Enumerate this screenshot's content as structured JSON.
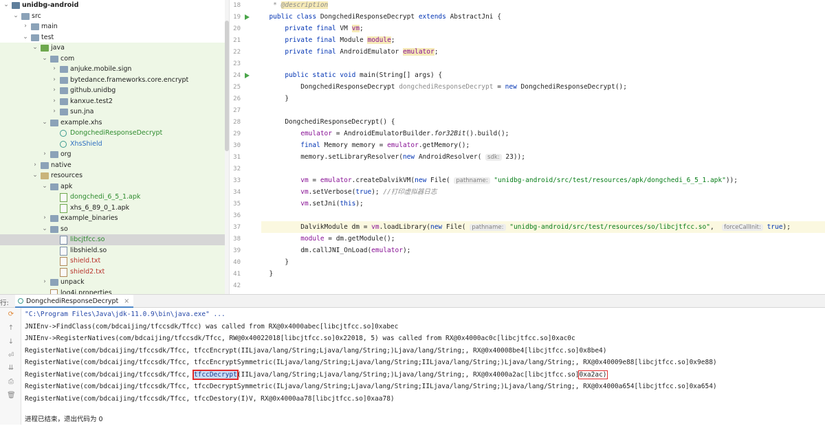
{
  "project_tree": {
    "items": [
      {
        "label": "unidbg-android",
        "depth": 0,
        "expanded": true,
        "icon": "project-folder-icon",
        "kind": "project",
        "style": "bold"
      },
      {
        "label": "src",
        "depth": 1,
        "expanded": true,
        "icon": "folder-icon",
        "kind": "folder"
      },
      {
        "label": "main",
        "depth": 2,
        "expanded": false,
        "icon": "folder-icon",
        "kind": "folder"
      },
      {
        "label": "test",
        "depth": 2,
        "expanded": true,
        "icon": "folder-icon",
        "kind": "folder"
      },
      {
        "label": "java",
        "depth": 3,
        "expanded": true,
        "icon": "test-source-folder-icon",
        "kind": "green-folder",
        "test": true
      },
      {
        "label": "com",
        "depth": 4,
        "expanded": true,
        "icon": "package-icon",
        "kind": "folder",
        "test": true
      },
      {
        "label": "anjuke.mobile.sign",
        "depth": 5,
        "expanded": false,
        "icon": "package-icon",
        "kind": "folder",
        "test": true
      },
      {
        "label": "bytedance.frameworks.core.encrypt",
        "depth": 5,
        "expanded": false,
        "icon": "package-icon",
        "kind": "folder",
        "test": true
      },
      {
        "label": "github.unidbg",
        "depth": 5,
        "expanded": false,
        "icon": "package-icon",
        "kind": "folder",
        "test": true
      },
      {
        "label": "kanxue.test2",
        "depth": 5,
        "expanded": false,
        "icon": "package-icon",
        "kind": "folder",
        "test": true
      },
      {
        "label": "sun.jna",
        "depth": 5,
        "expanded": false,
        "icon": "package-icon",
        "kind": "folder",
        "test": true
      },
      {
        "label": "example.xhs",
        "depth": 4,
        "expanded": true,
        "icon": "package-icon",
        "kind": "folder",
        "test": true
      },
      {
        "label": "DongchediResponseDecrypt",
        "depth": 5,
        "icon": "java-class-icon",
        "kind": "class",
        "color": "green",
        "test": true
      },
      {
        "label": "XhsShield",
        "depth": 5,
        "icon": "java-class-icon",
        "kind": "class",
        "color": "blue",
        "test": true
      },
      {
        "label": "org",
        "depth": 4,
        "expanded": false,
        "icon": "package-icon",
        "kind": "folder",
        "test": true
      },
      {
        "label": "native",
        "depth": 3,
        "expanded": false,
        "icon": "folder-icon",
        "kind": "folder",
        "test": true
      },
      {
        "label": "resources",
        "depth": 3,
        "expanded": true,
        "icon": "resources-folder-icon",
        "kind": "res-folder",
        "test": true
      },
      {
        "label": "apk",
        "depth": 4,
        "expanded": true,
        "icon": "folder-icon",
        "kind": "folder",
        "test": true
      },
      {
        "label": "dongchedi_6_5_1.apk",
        "depth": 5,
        "icon": "apk-file-icon",
        "kind": "apk",
        "color": "green",
        "test": true
      },
      {
        "label": "xhs_6_89_0_1.apk",
        "depth": 5,
        "icon": "apk-file-icon",
        "kind": "apk",
        "test": true
      },
      {
        "label": "example_binaries",
        "depth": 4,
        "expanded": false,
        "icon": "folder-icon",
        "kind": "folder",
        "test": true
      },
      {
        "label": "so",
        "depth": 4,
        "expanded": true,
        "icon": "folder-icon",
        "kind": "folder",
        "test": true
      },
      {
        "label": "libcjtfcc.so",
        "depth": 5,
        "icon": "so-file-icon",
        "kind": "so",
        "color": "green",
        "selected": true,
        "test": true
      },
      {
        "label": "libshield.so",
        "depth": 5,
        "icon": "so-file-icon",
        "kind": "so",
        "test": true
      },
      {
        "label": "shield.txt",
        "depth": 5,
        "icon": "text-file-icon",
        "kind": "txt",
        "color": "red",
        "test": true
      },
      {
        "label": "shield2.txt",
        "depth": 5,
        "icon": "text-file-icon",
        "kind": "txt",
        "color": "red",
        "test": true
      },
      {
        "label": "unpack",
        "depth": 4,
        "expanded": false,
        "icon": "folder-icon",
        "kind": "folder",
        "test": true
      },
      {
        "label": "log4j.properties",
        "depth": 4,
        "icon": "properties-file-icon",
        "kind": "txt",
        "test": true
      }
    ]
  },
  "editor": {
    "lines": [
      {
        "n": "18",
        "parts": [
          {
            "t": " * ",
            "c": "cmt"
          },
          {
            "t": "@description",
            "c": "cmt warn"
          }
        ]
      },
      {
        "n": "19",
        "run": true,
        "parts": [
          {
            "t": "public class ",
            "c": "kw"
          },
          {
            "t": "DongchediResponseDecrypt "
          },
          {
            "t": "extends ",
            "c": "kw"
          },
          {
            "t": "AbstractJni {"
          }
        ]
      },
      {
        "n": "20",
        "parts": [
          {
            "t": "    "
          },
          {
            "t": "private final ",
            "c": "kw"
          },
          {
            "t": "VM "
          },
          {
            "t": "vm",
            "c": "fld warn"
          },
          {
            "t": ";"
          }
        ]
      },
      {
        "n": "21",
        "parts": [
          {
            "t": "    "
          },
          {
            "t": "private final ",
            "c": "kw"
          },
          {
            "t": "Module "
          },
          {
            "t": "module",
            "c": "fld warn"
          },
          {
            "t": ";"
          }
        ]
      },
      {
        "n": "22",
        "parts": [
          {
            "t": "    "
          },
          {
            "t": "private final ",
            "c": "kw"
          },
          {
            "t": "AndroidEmulator "
          },
          {
            "t": "emulator",
            "c": "fld warn"
          },
          {
            "t": ";"
          }
        ]
      },
      {
        "n": "23",
        "parts": []
      },
      {
        "n": "24",
        "run": true,
        "parts": [
          {
            "t": "    "
          },
          {
            "t": "public static void ",
            "c": "kw"
          },
          {
            "t": "main(String[] args) {"
          }
        ]
      },
      {
        "n": "25",
        "parts": [
          {
            "t": "        DongchediResponseDecrypt "
          },
          {
            "t": "dongchediResponseDecrypt",
            "c": "gray"
          },
          {
            "t": " = "
          },
          {
            "t": "new ",
            "c": "kw"
          },
          {
            "t": "DongchediResponseDecrypt();"
          }
        ]
      },
      {
        "n": "26",
        "parts": [
          {
            "t": "    }"
          }
        ]
      },
      {
        "n": "27",
        "parts": []
      },
      {
        "n": "28",
        "parts": [
          {
            "t": "    DongchediResponseDecrypt() {"
          }
        ]
      },
      {
        "n": "29",
        "parts": [
          {
            "t": "        "
          },
          {
            "t": "emulator",
            "c": "fld"
          },
          {
            "t": " = AndroidEmulatorBuilder."
          },
          {
            "t": "for32Bit",
            "c": "static-it"
          },
          {
            "t": "().build();"
          }
        ]
      },
      {
        "n": "30",
        "parts": [
          {
            "t": "        "
          },
          {
            "t": "final ",
            "c": "kw"
          },
          {
            "t": "Memory memory = "
          },
          {
            "t": "emulator",
            "c": "fld"
          },
          {
            "t": ".getMemory();"
          }
        ]
      },
      {
        "n": "31",
        "parts": [
          {
            "t": "        memory.setLibraryResolver("
          },
          {
            "t": "new ",
            "c": "kw"
          },
          {
            "t": "AndroidResolver( "
          },
          {
            "t": "sdk:",
            "c": "hint"
          },
          {
            "t": " 23));"
          }
        ]
      },
      {
        "n": "32",
        "parts": []
      },
      {
        "n": "33",
        "parts": [
          {
            "t": "        "
          },
          {
            "t": "vm",
            "c": "fld"
          },
          {
            "t": " = "
          },
          {
            "t": "emulator",
            "c": "fld"
          },
          {
            "t": ".createDalvikVM("
          },
          {
            "t": "new ",
            "c": "kw"
          },
          {
            "t": "File( "
          },
          {
            "t": "pathname:",
            "c": "hint"
          },
          {
            "t": " "
          },
          {
            "t": "\"unidbg-android/src/test/resources/apk/dongchedi_6_5_1.apk\"",
            "c": "str"
          },
          {
            "t": "));"
          }
        ]
      },
      {
        "n": "34",
        "parts": [
          {
            "t": "        "
          },
          {
            "t": "vm",
            "c": "fld"
          },
          {
            "t": ".setVerbose("
          },
          {
            "t": "true",
            "c": "kw"
          },
          {
            "t": "); "
          },
          {
            "t": "//打印虚拟器日志",
            "c": "cmt"
          }
        ]
      },
      {
        "n": "35",
        "parts": [
          {
            "t": "        "
          },
          {
            "t": "vm",
            "c": "fld"
          },
          {
            "t": ".setJni("
          },
          {
            "t": "this",
            "c": "kw"
          },
          {
            "t": ");"
          }
        ]
      },
      {
        "n": "36",
        "parts": []
      },
      {
        "n": "37",
        "hl": true,
        "parts": [
          {
            "t": "        DalvikModule dm = "
          },
          {
            "t": "vm",
            "c": "fld"
          },
          {
            "t": ".loadLibrary("
          },
          {
            "t": "new ",
            "c": "kw"
          },
          {
            "t": "File( "
          },
          {
            "t": "pathname:",
            "c": "hint"
          },
          {
            "t": " "
          },
          {
            "t": "\"unidbg-android/src/test/resources/so/libcjtfcc.so\"",
            "c": "str"
          },
          {
            "t": ",  "
          },
          {
            "t": "forceCallInit:",
            "c": "hint"
          },
          {
            "t": " "
          },
          {
            "t": "true",
            "c": "kw"
          },
          {
            "t": ");"
          }
        ]
      },
      {
        "n": "38",
        "parts": [
          {
            "t": "        "
          },
          {
            "t": "module",
            "c": "fld"
          },
          {
            "t": " = dm.getModule();"
          }
        ]
      },
      {
        "n": "39",
        "parts": [
          {
            "t": "        dm.callJNI_OnLoad("
          },
          {
            "t": "emulator",
            "c": "fld"
          },
          {
            "t": ");"
          }
        ]
      },
      {
        "n": "40",
        "parts": [
          {
            "t": "    }"
          }
        ]
      },
      {
        "n": "41",
        "parts": [
          {
            "t": "}"
          }
        ]
      },
      {
        "n": "42",
        "parts": []
      }
    ]
  },
  "run_panel": {
    "label": "行:",
    "tab_label": "DongchediResponseDecrypt",
    "tab_close": "×",
    "tools": [
      {
        "icon": "rerun-icon",
        "glyph": "⟳"
      },
      {
        "icon": "scroll-up-icon",
        "glyph": "↑"
      },
      {
        "icon": "scroll-down-icon",
        "glyph": "↓"
      },
      {
        "icon": "soft-wrap-icon",
        "glyph": "⏎"
      },
      {
        "icon": "scroll-to-end-icon",
        "glyph": "⇊"
      },
      {
        "icon": "print-icon",
        "glyph": "⎙"
      },
      {
        "icon": "trash-icon",
        "glyph": "🗑"
      }
    ],
    "output": {
      "cmd": "\"C:\\Program Files\\Java\\jdk-11.0.9\\bin\\java.exe\" ...",
      "line1": "JNIEnv->FindClass(com/bdcaijing/tfccsdk/Tfcc) was called from RX@0x4000abec[libcjtfcc.so]0xabec",
      "line2": "JNIEnv->RegisterNatives(com/bdcaijing/tfccsdk/Tfcc, RW@0x40022018[libcjtfcc.so]0x22018, 5) was called from RX@0x4000ac0c[libcjtfcc.so]0xac0c",
      "line3": "RegisterNative(com/bdcaijing/tfccsdk/Tfcc, tfccEncrypt(IILjava/lang/String;Ljava/lang/String;)Ljava/lang/String;, RX@0x40008be4[libcjtfcc.so]0x8be4)",
      "line4": "RegisterNative(com/bdcaijing/tfccsdk/Tfcc, tfccEncryptSymmetric(ILjava/lang/String;Ljava/lang/String;IILjava/lang/String;)Ljava/lang/String;, RX@0x40009e88[libcjtfcc.so]0x9e88)",
      "line5_pre": "RegisterNative(com/bdcaijing/tfccsdk/Tfcc, ",
      "line5_sel": "tfccDecrypt",
      "line5_mid": "(IILjava/lang/String;Ljava/lang/String;)Ljava/lang/String;, RX@0x4000a2ac[libcjtfcc.so]",
      "line5_box": "0xa2ac)",
      "line6": "RegisterNative(com/bdcaijing/tfccsdk/Tfcc, tfccDecryptSymmetric(ILjava/lang/String;Ljava/lang/String;IILjava/lang/String;)Ljava/lang/String;, RX@0x4000a654[libcjtfcc.so]0xa654)",
      "line7": "RegisterNative(com/bdcaijing/tfccsdk/Tfcc, tfccDestory(I)V, RX@0x4000aa78[libcjtfcc.so]0xaa78)",
      "exit": "进程已结束，退出代码为 0"
    }
  }
}
